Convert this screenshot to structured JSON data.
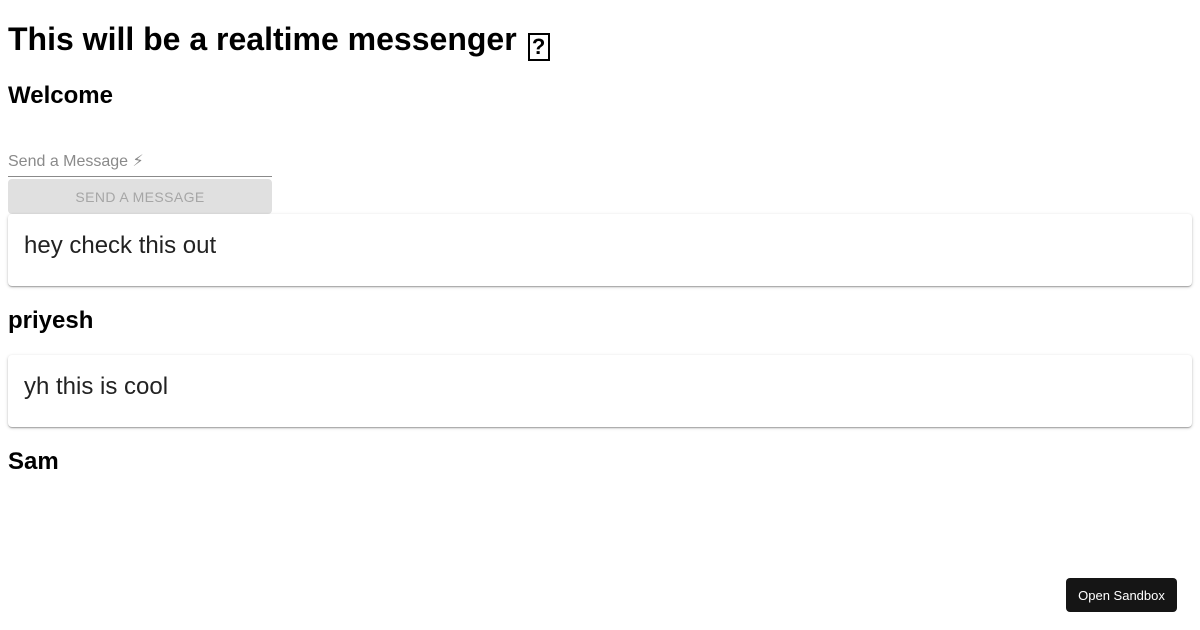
{
  "page": {
    "title": "This will be a realtime messenger",
    "title_glyph": "?",
    "greeting": "Welcome"
  },
  "composer": {
    "placeholder": "Send a Message ⚡",
    "value": "",
    "send_label": "Send a Message"
  },
  "messages": [
    {
      "text": "hey check this out",
      "author": "priyesh"
    },
    {
      "text": "yh this is cool",
      "author": "Sam"
    }
  ],
  "footer": {
    "sandbox_label": "Open Sandbox"
  }
}
